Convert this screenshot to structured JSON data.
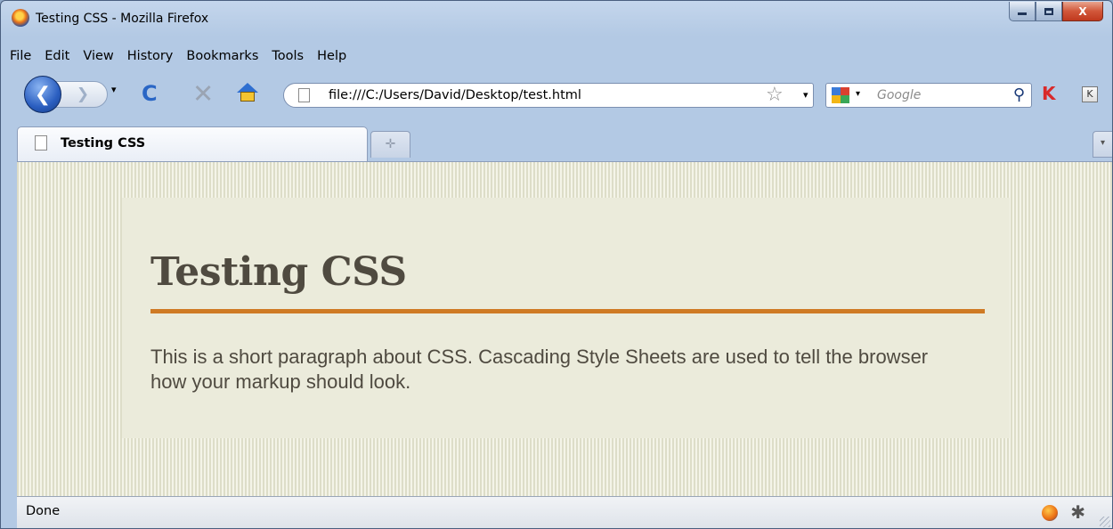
{
  "window": {
    "title": "Testing CSS - Mozilla Firefox",
    "controls": {
      "minimize": "",
      "maximize": "",
      "close": "X"
    }
  },
  "menubar": {
    "items": [
      "File",
      "Edit",
      "View",
      "History",
      "Bookmarks",
      "Tools",
      "Help"
    ]
  },
  "navbar": {
    "back_glyph": "❮",
    "forward_glyph": "❯",
    "reload_glyph": "C",
    "stop_glyph": "✕",
    "url": "file:///C:/Users/David/Desktop/test.html",
    "bookmark_star": "☆",
    "dropdown_glyph": "▾",
    "search": {
      "placeholder": "Google",
      "engine_icon": "google-icon"
    },
    "search_glyph": "⚲",
    "addon_icons": [
      "k-red-icon",
      "k-box-icon"
    ],
    "addon1_glyph": "K",
    "addon2_glyph": "K"
  },
  "tabs": {
    "active_label": "Testing CSS",
    "newtab_glyph": "✛",
    "list_glyph": "▾"
  },
  "page": {
    "heading": "Testing CSS",
    "paragraph": "This is a short paragraph about CSS. Cascading Style Sheets are used to tell the browser how your markup should look.",
    "colors": {
      "background_stripe_dark": "#ddddc8",
      "background_stripe_light": "#f4f4e8",
      "content_bg": "#ebebdb",
      "text": "#4f4a40",
      "rule": "#cf7a24"
    }
  },
  "statusbar": {
    "text": "Done",
    "icons": [
      "firebug-icon",
      "bug-icon"
    ],
    "bug_glyph": "✱"
  }
}
